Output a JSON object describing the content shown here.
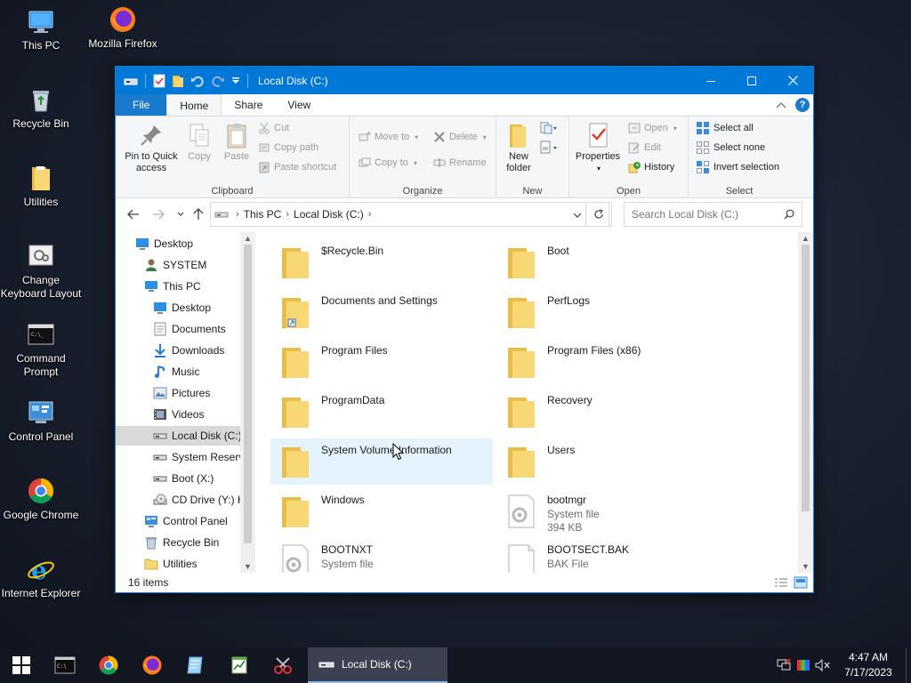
{
  "desktop": {
    "icons": [
      {
        "label": "This PC",
        "icon": "this-pc-icon"
      },
      {
        "label": "Mozilla Firefox",
        "icon": "firefox-icon"
      },
      {
        "label": "Recycle Bin",
        "icon": "recycle-bin-icon"
      },
      {
        "label": "Utilities",
        "icon": "folder-icon"
      },
      {
        "label": "Change Keyboard Layout",
        "icon": "keyboard-layout-icon"
      },
      {
        "label": "Command Prompt",
        "icon": "command-prompt-icon"
      },
      {
        "label": "Control Panel",
        "icon": "control-panel-icon"
      },
      {
        "label": "Google Chrome",
        "icon": "chrome-icon"
      },
      {
        "label": "Internet Explorer",
        "icon": "internet-explorer-icon"
      }
    ]
  },
  "window": {
    "title": "Local Disk (C:)",
    "ribbon_tabs": [
      "File",
      "Home",
      "Share",
      "View"
    ],
    "active_tab": "Home",
    "ribbon": {
      "clipboard": {
        "label": "Clipboard",
        "pin": "Pin to Quick access",
        "copy": "Copy",
        "paste": "Paste",
        "cut": "Cut",
        "copy_path": "Copy path",
        "paste_shortcut": "Paste shortcut"
      },
      "organize": {
        "label": "Organize",
        "move_to": "Move to",
        "copy_to": "Copy to",
        "delete": "Delete",
        "rename": "Rename"
      },
      "new": {
        "label": "New",
        "new_folder": "New folder"
      },
      "open": {
        "label": "Open",
        "properties": "Properties",
        "open": "Open",
        "edit": "Edit",
        "history": "History"
      },
      "select": {
        "label": "Select",
        "select_all": "Select all",
        "select_none": "Select none",
        "invert_selection": "Invert selection"
      }
    },
    "address": {
      "crumbs": [
        "This PC",
        "Local Disk (C:)"
      ]
    },
    "search": {
      "placeholder": "Search Local Disk (C:)"
    },
    "nav_tree": [
      {
        "label": "Desktop",
        "icon": "desktop-icon",
        "level": 0
      },
      {
        "label": "SYSTEM",
        "icon": "user-icon",
        "level": 1
      },
      {
        "label": "This PC",
        "icon": "this-pc-icon",
        "level": 1
      },
      {
        "label": "Desktop",
        "icon": "desktop-icon",
        "level": 2
      },
      {
        "label": "Documents",
        "icon": "documents-icon",
        "level": 2
      },
      {
        "label": "Downloads",
        "icon": "downloads-icon",
        "level": 2
      },
      {
        "label": "Music",
        "icon": "music-icon",
        "level": 2
      },
      {
        "label": "Pictures",
        "icon": "pictures-icon",
        "level": 2
      },
      {
        "label": "Videos",
        "icon": "videos-icon",
        "level": 2
      },
      {
        "label": "Local Disk (C:)",
        "icon": "drive-icon",
        "level": 2,
        "selected": true
      },
      {
        "label": "System Reserve",
        "icon": "drive-icon",
        "level": 2
      },
      {
        "label": "Boot (X:)",
        "icon": "drive-icon",
        "level": 2
      },
      {
        "label": "CD Drive (Y:) H",
        "icon": "cd-drive-icon",
        "level": 2
      },
      {
        "label": "Control Panel",
        "icon": "control-panel-icon",
        "level": 1
      },
      {
        "label": "Recycle Bin",
        "icon": "recycle-bin-icon",
        "level": 1
      },
      {
        "label": "Utilities",
        "icon": "folder-icon",
        "level": 1
      }
    ],
    "files": [
      {
        "name": "$Recycle.Bin",
        "kind": "folder"
      },
      {
        "name": "Boot",
        "kind": "folder"
      },
      {
        "name": "Documents and Settings",
        "kind": "folder-shortcut"
      },
      {
        "name": "PerfLogs",
        "kind": "folder"
      },
      {
        "name": "Program Files",
        "kind": "folder"
      },
      {
        "name": "Program Files (x86)",
        "kind": "folder"
      },
      {
        "name": "ProgramData",
        "kind": "folder"
      },
      {
        "name": "Recovery",
        "kind": "folder"
      },
      {
        "name": "System Volume Information",
        "kind": "folder",
        "hover": true
      },
      {
        "name": "Users",
        "kind": "folder"
      },
      {
        "name": "Windows",
        "kind": "folder"
      },
      {
        "name": "bootmgr",
        "kind": "system-file",
        "type": "System file",
        "size": "394 KB"
      },
      {
        "name": "BOOTNXT",
        "kind": "system-file",
        "type": "System file",
        "size": ""
      },
      {
        "name": "BOOTSECT.BAK",
        "kind": "file",
        "type": "BAK File",
        "size": ""
      }
    ],
    "status": {
      "item_count": "16 items"
    }
  },
  "taskbar": {
    "apps": [
      "command-prompt-icon",
      "chrome-icon",
      "firefox-icon",
      "notepad-icon",
      "spreadsheet-icon",
      "snipping-tool-icon"
    ],
    "active_window": "Local Disk (C:)",
    "clock": {
      "time": "4:47 AM",
      "date": "7/17/2023"
    }
  },
  "colors": {
    "accent": "#0078d7",
    "file_tab": "#1979ca",
    "selection": "#cce8ff",
    "hover": "#e5f3ff",
    "folder": "#f8d775",
    "taskbar": "#121620"
  }
}
